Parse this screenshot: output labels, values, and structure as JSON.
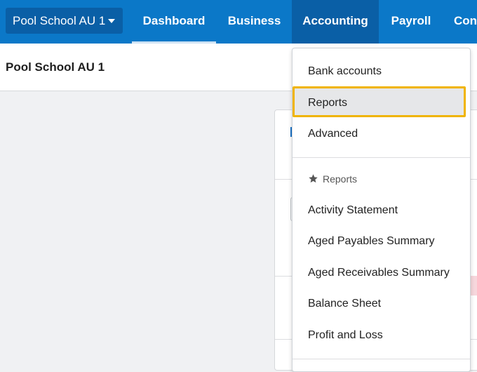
{
  "nav": {
    "org_selector": "Pool School AU 1",
    "tabs": [
      "Dashboard",
      "Business",
      "Accounting",
      "Payroll",
      "Con"
    ],
    "active_tab": "Accounting",
    "accent_color": "#0b78c8",
    "active_color": "#0a5fa6"
  },
  "page": {
    "title": "Pool School AU 1"
  },
  "menu": {
    "items": [
      "Bank accounts",
      "Reports",
      "Advanced"
    ],
    "highlighted": "Reports",
    "highlight_color": "#f0b400",
    "section_label": "Reports",
    "section_icon": "star-icon",
    "report_items": [
      "Activity Statement",
      "Aged Payables Summary",
      "Aged Receivables Summary",
      "Balance Sheet",
      "Profit and Loss"
    ]
  }
}
